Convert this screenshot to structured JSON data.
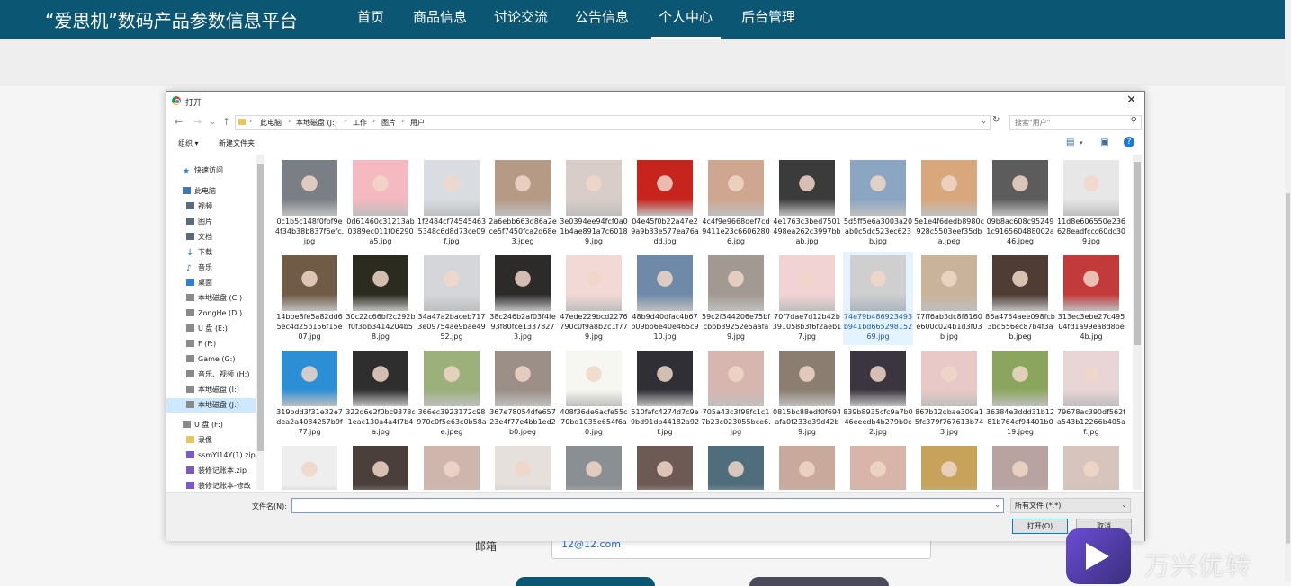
{
  "site": {
    "title": "“爱思机”数码产品参数信息平台",
    "nav": [
      "首页",
      "商品信息",
      "讨论交流",
      "公告信息",
      "个人中心",
      "后台管理"
    ],
    "active_nav": "个人中心",
    "brand_color": "#0b5773"
  },
  "background_form": {
    "email_label": "邮箱",
    "email_value": "12@12.com"
  },
  "dialog": {
    "title": "打开",
    "breadcrumb": [
      "此电脑",
      "本地磁盘 (J:)",
      "工作",
      "图片",
      "用户"
    ],
    "search_placeholder": "搜索\"用户\"",
    "toolbar": {
      "organize": "组织 ▾",
      "new_folder": "新建文件夹"
    },
    "sidebar": [
      {
        "label": "快速访问",
        "icon": "star-icon"
      },
      {
        "label": "此电脑",
        "icon": "computer-icon"
      },
      {
        "label": "视频",
        "icon": "video-folder-icon"
      },
      {
        "label": "图片",
        "icon": "pictures-folder-icon"
      },
      {
        "label": "文档",
        "icon": "documents-folder-icon"
      },
      {
        "label": "下载",
        "icon": "download-icon"
      },
      {
        "label": "音乐",
        "icon": "music-icon"
      },
      {
        "label": "桌面",
        "icon": "desktop-icon"
      },
      {
        "label": "本地磁盘 (C:)",
        "icon": "drive-icon"
      },
      {
        "label": "ZongHe (D:)",
        "icon": "drive-icon"
      },
      {
        "label": "U 盘 (E:)",
        "icon": "drive-icon"
      },
      {
        "label": "F (F:)",
        "icon": "drive-icon"
      },
      {
        "label": "Game (G:)",
        "icon": "drive-icon"
      },
      {
        "label": "音乐、视频 (H:)",
        "icon": "drive-icon"
      },
      {
        "label": "本地磁盘 (I:)",
        "icon": "drive-icon"
      },
      {
        "label": "本地磁盘 (J:)",
        "icon": "drive-icon"
      },
      {
        "label": "U 盘 (F:)",
        "icon": "usb-drive-icon"
      },
      {
        "label": "录像",
        "icon": "folder-icon"
      },
      {
        "label": "ssmYl14Y(1).zip",
        "icon": "zip-icon"
      },
      {
        "label": "装修记账本.zip",
        "icon": "zip-icon"
      },
      {
        "label": "装修记账本-修改",
        "icon": "zip-icon"
      }
    ],
    "selected_sidebar": "本地磁盘 (J:)",
    "files": [
      {
        "name": "0c1b5c148f0fbf9e4f34b38b837f6efc.jpg",
        "color": "#7a7f86"
      },
      {
        "name": "0d61460c31213ab0389ec011f06290a5.jpg",
        "color": "#f4b9c1"
      },
      {
        "name": "1f2484cf745454635348c6d8d73ce09f.jpg",
        "color": "#d9dde2"
      },
      {
        "name": "2a6ebb663d86a2ece5f7450fca2d68e3.jpeg",
        "color": "#b59a86"
      },
      {
        "name": "3e0394ee94fcf0a01b4ae891a7c60189.jpg",
        "color": "#d8cdc9"
      },
      {
        "name": "04e45f0b22a47e29a9b33e577ea76add.jpg",
        "color": "#c7241e"
      },
      {
        "name": "4c4f9e9668def7cd9411e23c66062806.jpg",
        "color": "#cfa68f"
      },
      {
        "name": "4e1763c3bed7501498ea262c3997bbab.jpg",
        "color": "#3b3b3b"
      },
      {
        "name": "5d5ff5e6a3003a20ab0c5dc523ec623b.jpg",
        "color": "#8aa6c2"
      },
      {
        "name": "5e1e4f6dedb8980c928c5503eef35dba.jpeg",
        "color": "#d9a77c"
      },
      {
        "name": "09b8ac608c952491c916560488002a46.jpeg",
        "color": "#5c5c5c"
      },
      {
        "name": "11d8e606550e236628eadfccc60dc309.jpg",
        "color": "#e7e7e7"
      },
      {
        "name": "14bbe8fe5a82dd65ec4d25b156f15e07.jpg",
        "color": "#6f5b46"
      },
      {
        "name": "30c22c66bf2c292bf0f3bb3414204b58.jpg",
        "color": "#2b2b20"
      },
      {
        "name": "34a47a2baceb7173e09754ae9bae4952.jpg",
        "color": "#d4d6da"
      },
      {
        "name": "38c246b2af03f4fe93f80fce13378273.jpg",
        "color": "#2d2a2a"
      },
      {
        "name": "47ede229bcd2276790c0f9a8b2c1f779.jpg",
        "color": "#f2d9d6"
      },
      {
        "name": "48b9d40dfac4b67b09bb6e40e465c910.jpg",
        "color": "#6f8aa8"
      },
      {
        "name": "59c2f344206e75bfcbbb39252e5aafa9.jpg",
        "color": "#a29a92"
      },
      {
        "name": "70f7dae7d12b42b391058b3f6f2aeb17.jpg",
        "color": "#f1d3d4"
      },
      {
        "name": "74e79b486923493b941bd66529815269.jpg",
        "color": "#cfcfcf"
      },
      {
        "name": "77ff6ab3dc8f8160e600c024b1d3f03b.jpg",
        "color": "#c9b49b"
      },
      {
        "name": "86a4754aee098fcb3bd556ec87b4f3ab.jpeg",
        "color": "#4e3c35"
      },
      {
        "name": "313ec3ebe27c49504fd1a99ea8d8be4b.jpg",
        "color": "#c23a3a"
      },
      {
        "name": "319bdd3f31e32e7dea2a4084257b9f77.jpg",
        "color": "#2c8fd6"
      },
      {
        "name": "322d6e2f0bc9378c1eac130a4a4f7b4a.jpg",
        "color": "#2e2e2e"
      },
      {
        "name": "366ec3923172c98970c0f5e63c0b58ae.jpeg",
        "color": "#9bb07a"
      },
      {
        "name": "367e78054dfe65723e4f77e4bb1ed2b0.jpeg",
        "color": "#9b8f88"
      },
      {
        "name": "408f36de6acfe55c70bd1035e654f6a0.jpg",
        "color": "#f7f7f2"
      },
      {
        "name": "510fafc4274d7c9e9bd91db44182a92f.jpg",
        "color": "#2f2f35"
      },
      {
        "name": "705a43c3f98fc1c17b23c023055bce6.jpg",
        "color": "#d8b6b0"
      },
      {
        "name": "0815bc88edf0f694afa0f233e39d42b9.jpg",
        "color": "#8b7e70"
      },
      {
        "name": "839b8935cfc9a7b046eeedb4b279b0c2.jpg",
        "color": "#3b3540"
      },
      {
        "name": "867b12dbae309a15fc379f767613b743.jpg",
        "color": "#e8c9c7"
      },
      {
        "name": "36384e3ddd31b1281b764cf94401b019.jpeg",
        "color": "#8ca55e"
      },
      {
        "name": "79678ac390df562fa543b12266b405af.jpg",
        "color": "#e9d4d6"
      },
      {
        "name": "",
        "color": "#eeeeee"
      },
      {
        "name": "",
        "color": "#4a3f3a"
      },
      {
        "name": "",
        "color": "#cfb6ad"
      },
      {
        "name": "",
        "color": "#e5e0dc"
      },
      {
        "name": "",
        "color": "#8a8f94"
      },
      {
        "name": "",
        "color": "#6d5a55"
      },
      {
        "name": "",
        "color": "#4f6d7c"
      },
      {
        "name": "",
        "color": "#c9a99b"
      },
      {
        "name": "",
        "color": "#d9b4a8"
      },
      {
        "name": "",
        "color": "#c7a25a"
      },
      {
        "name": "",
        "color": "#b9a3a1"
      },
      {
        "name": "",
        "color": "#d6c4bd"
      }
    ],
    "hovered_file": "74e79b486923493b941bd66529815269.jpg",
    "filename_label": "文件名(N):",
    "filename_value": "",
    "filetype": "所有文件 (*.*)",
    "open_button": "打开(O)",
    "cancel_button": "取消"
  },
  "watermark": {
    "text": "万兴优转"
  }
}
